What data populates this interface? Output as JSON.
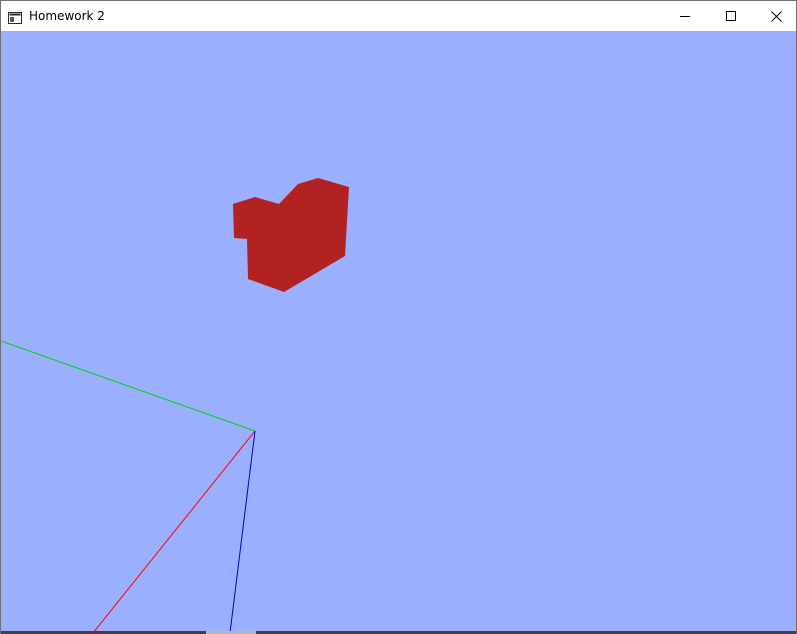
{
  "window": {
    "title": "Homework 2",
    "controls": {
      "minimize": "minimize-icon",
      "maximize": "maximize-icon",
      "close": "close-icon"
    }
  },
  "scene": {
    "background_color": "#9ab0fe",
    "object_color": "#b22222",
    "axes": {
      "x_color": "#ff0000",
      "y_color": "#00d000",
      "z_color": "#0000d0"
    }
  }
}
